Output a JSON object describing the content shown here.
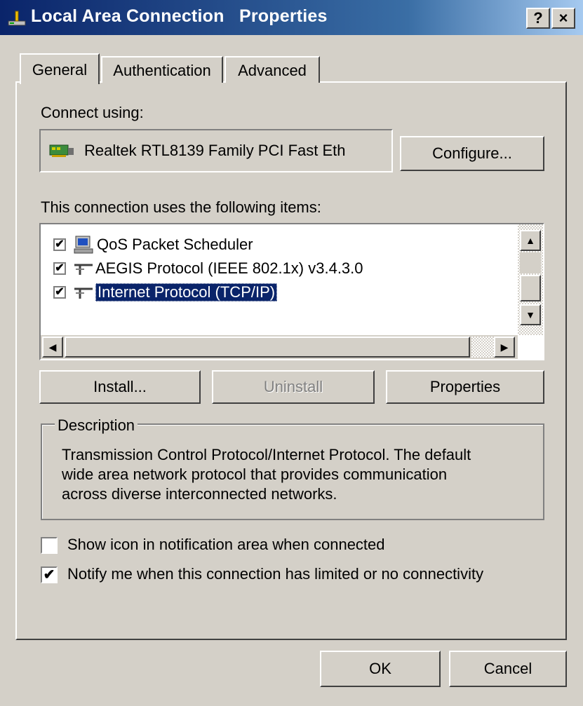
{
  "window": {
    "title": "Local Area Connection   Properties",
    "help_button": "?",
    "close_button": "×"
  },
  "tabs": [
    {
      "label": "General",
      "selected": true
    },
    {
      "label": "Authentication",
      "selected": false
    },
    {
      "label": "Advanced",
      "selected": false
    }
  ],
  "general": {
    "connect_using_label": "Connect using:",
    "adapter_name": "Realtek RTL8139 Family PCI Fast Eth",
    "configure_button": "Configure...",
    "items_label": "This connection uses the following items:",
    "items": [
      {
        "label": "QoS Packet Scheduler",
        "checked": true,
        "icon": "network-scheduler-icon",
        "selected": false
      },
      {
        "label": "AEGIS Protocol (IEEE 802.1x) v3.4.3.0",
        "checked": true,
        "icon": "protocol-icon",
        "selected": false
      },
      {
        "label": "Internet Protocol (TCP/IP)",
        "checked": true,
        "icon": "protocol-icon",
        "selected": true
      }
    ],
    "install_button": "Install...",
    "uninstall_button": "Uninstall",
    "properties_button": "Properties",
    "description_legend": "Description",
    "description_lines": [
      "Transmission Control Protocol/Internet Protocol. The default",
      "wide area network protocol that provides communication",
      "across diverse interconnected networks."
    ],
    "show_icon_label": "Show icon in notification area when connected",
    "show_icon_checked": false,
    "notify_label": "Notify me when this connection has limited or no connectivity",
    "notify_checked": true
  },
  "footer": {
    "ok_button": "OK",
    "cancel_button": "Cancel"
  },
  "colors": {
    "titlebar_start": "#0a246a",
    "titlebar_end": "#a6caf0",
    "selection": "#0a246a",
    "face": "#d4d0c8"
  }
}
